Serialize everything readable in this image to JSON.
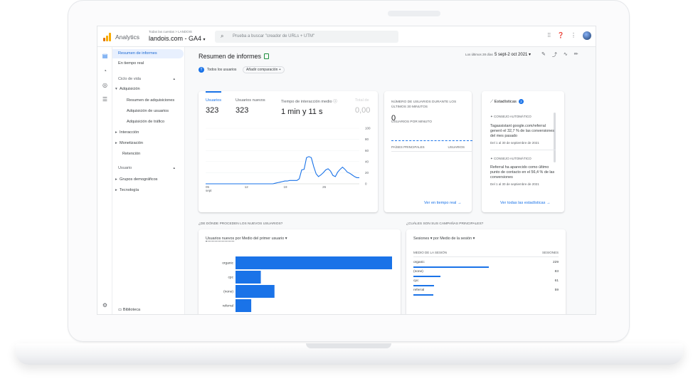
{
  "topbar": {
    "app_name": "Analytics",
    "account_path": "Todas las cuentas > LANDOIS",
    "property": "landois.com - GA4",
    "search_placeholder": "Prueba a buscar \"creador de URLs + UTM\""
  },
  "sidebar": {
    "items": [
      {
        "label": "Resumen de informes"
      },
      {
        "label": "En tiempo real"
      },
      {
        "label": "Ciclo de vida"
      },
      {
        "label": "Adquisición"
      },
      {
        "label": "Resumen de adquisiciones"
      },
      {
        "label": "Adquisición de usuarios"
      },
      {
        "label": "Adquisición de tráfico"
      },
      {
        "label": "Interacción"
      },
      {
        "label": "Monetización"
      },
      {
        "label": "Retención"
      },
      {
        "label": "Usuario"
      },
      {
        "label": "Grupos demográficos"
      },
      {
        "label": "Tecnología"
      }
    ],
    "library": "Biblioteca"
  },
  "header": {
    "title": "Resumen de informes",
    "date_prefix": "Los últimos 28 días",
    "date_range": "5 sept-2 oct 2021",
    "segment": "Todos los usuarios",
    "add_comparison": "Añadir comparación"
  },
  "overview": {
    "kpis": [
      {
        "label": "Usuarios",
        "value": "323"
      },
      {
        "label": "Usuarios nuevos",
        "value": "323"
      },
      {
        "label": "Tiempo de interacción medio",
        "value": "1 min y 11 s"
      },
      {
        "label": "Total de",
        "value": "0,00"
      }
    ]
  },
  "chart_data": {
    "type": "line",
    "series": [
      {
        "values": [
          0,
          0,
          0,
          0,
          0,
          0,
          0,
          0,
          0,
          0,
          0,
          0,
          0,
          0,
          0,
          0,
          0,
          0,
          0,
          0,
          0,
          0,
          0,
          0,
          0,
          0,
          0,
          0,
          0,
          1,
          2,
          3,
          4,
          5,
          5,
          6,
          6,
          6,
          6,
          9,
          25,
          26,
          47,
          49,
          47,
          31,
          18,
          13,
          16,
          20,
          25,
          27,
          23,
          15,
          13,
          21,
          26,
          30,
          26,
          21,
          19,
          16,
          13,
          11,
          11
        ]
      }
    ],
    "x_tick_labels": [
      "05 sept",
      "12",
      "19",
      "26"
    ],
    "y_ticks": [
      0,
      20,
      40,
      60,
      80,
      100
    ],
    "ylim": [
      0,
      100
    ]
  },
  "realtime": {
    "title": "Número de usuarios durante los últimos 30 minutos",
    "value": "0",
    "subtitle": "Usuarios por minuto",
    "col_country": "Países principales",
    "col_users": "Usuarios",
    "link": "Ver en tiempo real"
  },
  "insights": {
    "title": "Estadísticas",
    "count": "2",
    "items": [
      {
        "kicker": "Consejo automático",
        "text": "Tagassistant google.com/referral generó el 32,7 % de las conversiones del mes pasado",
        "date": "Del 1 al 30 de septiembre de 2021"
      },
      {
        "kicker": "Consejo automático",
        "text": "Referral ha aparecido como último punto de contacto en el 56,4 % de las conversiones",
        "date": "Del 1 al 30 de septiembre de 2021"
      }
    ],
    "link": "Ver todas las estadísticas"
  },
  "new_users": {
    "section_title": "¿De dónde proceden los nuevos usuarios?",
    "metric": "Usuarios nuevos",
    "dimension_label": "por Medio del primer usuario",
    "rows": [
      {
        "label": "organic",
        "value": 229
      },
      {
        "label": "cpc",
        "value": 37
      },
      {
        "label": "(none)",
        "value": 57
      },
      {
        "label": "referral",
        "value": 23
      }
    ]
  },
  "campaigns": {
    "section_title": "¿Cuáles son sus campañas principales?",
    "metric": "Sesiones",
    "dimension_label": "por Medio de la sesión",
    "col_medium": "Medio de la sesión",
    "col_sessions": "Sesiones",
    "rows": [
      {
        "medium": "organic",
        "sessions": "229",
        "share": 1.0
      },
      {
        "medium": "(none)",
        "sessions": "83",
        "share": 0.36
      },
      {
        "medium": "cpc",
        "sessions": "61",
        "share": 0.27
      },
      {
        "medium": "referral",
        "sessions": "59",
        "share": 0.26
      }
    ]
  }
}
